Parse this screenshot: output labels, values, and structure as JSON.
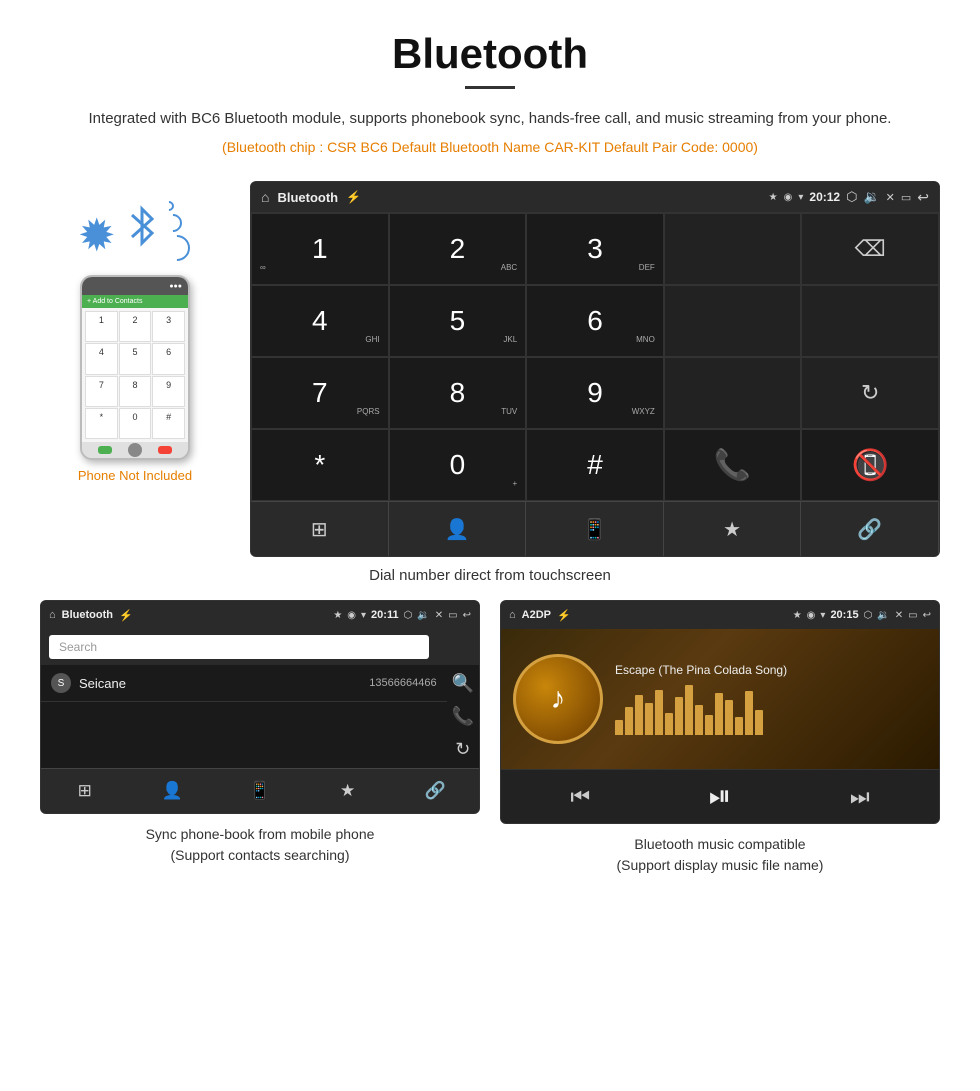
{
  "header": {
    "title": "Bluetooth",
    "subtitle": "Integrated with BC6 Bluetooth module, supports phonebook sync, hands-free call, and music streaming from your phone.",
    "info_line": "(Bluetooth chip : CSR BC6    Default Bluetooth Name CAR-KIT    Default Pair Code: 0000)"
  },
  "phone_label": "Phone Not Included",
  "car_screen": {
    "title": "Bluetooth",
    "time": "20:12",
    "dialpad": [
      {
        "key": "1",
        "sub": "∞"
      },
      {
        "key": "2",
        "sub": "ABC"
      },
      {
        "key": "3",
        "sub": "DEF"
      },
      {
        "key": "",
        "sub": ""
      },
      {
        "key": "⌫",
        "sub": ""
      },
      {
        "key": "4",
        "sub": "GHI"
      },
      {
        "key": "5",
        "sub": "JKL"
      },
      {
        "key": "6",
        "sub": "MNO"
      },
      {
        "key": "",
        "sub": ""
      },
      {
        "key": "",
        "sub": ""
      },
      {
        "key": "7",
        "sub": "PQRS"
      },
      {
        "key": "8",
        "sub": "TUV"
      },
      {
        "key": "9",
        "sub": "WXYZ"
      },
      {
        "key": "",
        "sub": ""
      },
      {
        "key": "↻",
        "sub": ""
      },
      {
        "key": "*",
        "sub": ""
      },
      {
        "key": "0",
        "sub": "+"
      },
      {
        "key": "#",
        "sub": ""
      },
      {
        "key": "📞",
        "sub": ""
      },
      {
        "key": "📵",
        "sub": ""
      }
    ]
  },
  "dial_caption": "Dial number direct from touchscreen",
  "phonebook_screen": {
    "title": "Bluetooth",
    "time": "20:11",
    "search_placeholder": "Search",
    "contact_name": "Seicane",
    "contact_number": "13566664466"
  },
  "music_screen": {
    "title": "A2DP",
    "time": "20:15",
    "song_title": "Escape (The Pina Colada Song)",
    "eq_heights": [
      15,
      28,
      40,
      32,
      45,
      22,
      38,
      50,
      30,
      20,
      42,
      35,
      18,
      44,
      25
    ]
  },
  "phonebook_caption": "Sync phone-book from mobile phone\n(Support contacts searching)",
  "music_caption": "Bluetooth music compatible\n(Support display music file name)"
}
